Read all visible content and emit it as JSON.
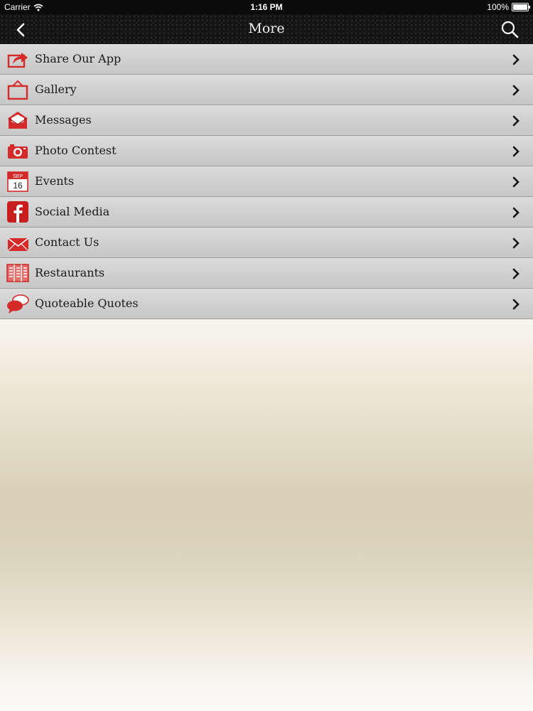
{
  "status_bar": {
    "carrier": "Carrier",
    "time": "1:16 PM",
    "battery": "100%"
  },
  "nav": {
    "title": "More",
    "back_icon": "chevron-left-icon",
    "search_icon": "search-icon"
  },
  "colors": {
    "icon_red": "#d42a2a",
    "nav_bg": "#151515",
    "row_bg": "#d0d0d0"
  },
  "menu": {
    "items": [
      {
        "label": "Share Our App",
        "icon": "share-icon"
      },
      {
        "label": "Gallery",
        "icon": "gallery-icon"
      },
      {
        "label": "Messages",
        "icon": "messages-icon"
      },
      {
        "label": "Photo Contest",
        "icon": "camera-icon"
      },
      {
        "label": "Events",
        "icon": "calendar-icon",
        "icon_text": {
          "month": "SEP",
          "day": "16"
        }
      },
      {
        "label": "Social Media",
        "icon": "facebook-icon"
      },
      {
        "label": "Contact Us",
        "icon": "envelope-icon"
      },
      {
        "label": "Restaurants",
        "icon": "restaurant-menu-icon"
      },
      {
        "label": "Quoteable Quotes",
        "icon": "speech-bubbles-icon"
      }
    ]
  }
}
